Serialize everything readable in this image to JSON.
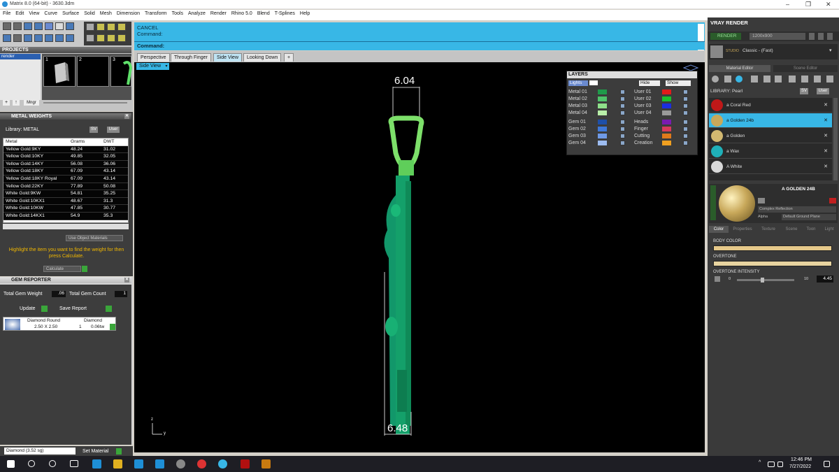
{
  "window": {
    "title": "Matrix 8.0 (64-bit) - 3630.3dm",
    "controls": [
      "–",
      "❐",
      "✕"
    ]
  },
  "menu": [
    "File",
    "Edit",
    "View",
    "Curve",
    "Surface",
    "Solid",
    "Mesh",
    "Dimension",
    "Transform",
    "Tools",
    "Analyze",
    "Render",
    "Rhino 5.0",
    "Blend",
    "T-Splines",
    "Help"
  ],
  "projects": {
    "title": "PROJECTS",
    "tree_item": "render",
    "thumbs": [
      "1",
      "2",
      "3"
    ],
    "btn_plus": "+",
    "btn_up": "↑",
    "btn_mngr": "Mngr"
  },
  "metal_weights": {
    "title": "METAL WEIGHTS",
    "library_label": "Library: METAL",
    "btn_sv": "SV",
    "btn_user": "User",
    "columns": [
      "Metal",
      "Grams",
      "DWT"
    ],
    "rows": [
      [
        "Yellow Gold:9KY",
        "48.24",
        "31.02"
      ],
      [
        "Yellow Gold:10KY",
        "49.85",
        "32.05"
      ],
      [
        "Yellow Gold:14KY",
        "56.08",
        "36.06"
      ],
      [
        "Yellow Gold:18KY",
        "67.09",
        "43.14"
      ],
      [
        "Yellow Gold:18KY Royal",
        "67.09",
        "43.14"
      ],
      [
        "Yellow Gold:22KY",
        "77.89",
        "50.08"
      ],
      [
        "White Gold:9KW",
        "54.81",
        "35.25"
      ],
      [
        "White Gold:10KX1",
        "48.67",
        "31.3"
      ],
      [
        "White Gold:10KW",
        "47.85",
        "30.77"
      ],
      [
        "White Gold:14KX1",
        "54.9",
        "35.3"
      ]
    ],
    "use_object_materials": "Use Object Materials",
    "hint": "Highlight the item you want to find the weight for then press Calculate.",
    "calculate": "Calculate"
  },
  "gem_reporter": {
    "title": "GEM REPORTER",
    "total_weight_label": "Total Gem Weight",
    "total_weight_value": ".06",
    "total_count_label": "Total Gem Count",
    "total_count_value": "1",
    "update": "Update",
    "save_report": "Save Report",
    "gem_shape": "Diamond Round",
    "gem_size": "2.50 X 2.50",
    "gem_type": "Diamond",
    "gem_count": "1",
    "gem_weight": "0.06tw"
  },
  "bottom_bar": {
    "material": "Diamond   (3.52 sg)",
    "set_material": "Set Material"
  },
  "command": {
    "line1": "CANCEL",
    "line2": "Command:",
    "prompt": "Command:"
  },
  "tabs": [
    "Perspective",
    "Through Finger",
    "Side View",
    "Looking Down"
  ],
  "active_tab": "Side View",
  "tab_add": "+",
  "viewport_label": "Side View",
  "dims": {
    "top": "6.04",
    "bottom": "6.48"
  },
  "axis": {
    "z": "z",
    "y": "y"
  },
  "layers": {
    "title": "LAYERS",
    "lights": "Lights",
    "hide": "Hide",
    "show": "Show",
    "left": [
      {
        "name": "Metal 01",
        "color": "#1f9a4a"
      },
      {
        "name": "Metal 02",
        "color": "#4fc36a"
      },
      {
        "name": "Metal 03",
        "color": "#8fe08a"
      },
      {
        "name": "Metal 04",
        "color": "#b9efa9"
      },
      {
        "name": "Gem 01",
        "color": "#1e4fa8"
      },
      {
        "name": "Gem 02",
        "color": "#3f78d8"
      },
      {
        "name": "Gem 03",
        "color": "#6f9ae6"
      },
      {
        "name": "Gem 04",
        "color": "#9dbcf0"
      }
    ],
    "right": [
      {
        "name": "User 01",
        "color": "#e01b1b"
      },
      {
        "name": "User 02",
        "color": "#1bbf2e"
      },
      {
        "name": "User 03",
        "color": "#1b2ee0"
      },
      {
        "name": "User 04",
        "color": "#9a9a9a"
      },
      {
        "name": "Heads",
        "color": "#7a1bb0"
      },
      {
        "name": "Finger",
        "color": "#d93a5a"
      },
      {
        "name": "Cutting",
        "color": "#e07a1b"
      },
      {
        "name": "Creation",
        "color": "#f0a020"
      }
    ]
  },
  "vray": {
    "title": "VRAY RENDER",
    "render_btn": "RENDER",
    "resolution": "1200x900",
    "preset_tag": "STUDIO",
    "preset": "Classic - (Fast)",
    "tabs": [
      "Material Editor",
      "Scene Editor"
    ],
    "library_label": "LIBRARY: Pearl",
    "btn_sv": "SV",
    "btn_user": "User",
    "materials": [
      {
        "name": "a Coral Red",
        "color": "#c01818"
      },
      {
        "name": "a Golden 24b",
        "color": "#c8a85a"
      },
      {
        "name": "a Golden",
        "color": "#d2b870"
      },
      {
        "name": "a Wax",
        "color": "#1fb0b8"
      },
      {
        "name": "A White",
        "color": "#d8d8d8"
      }
    ],
    "selected_index": 1,
    "material_name": "A GOLDEN 24B",
    "reflection": "Complex Reflection",
    "alpha_label": "Alpha",
    "ground": "Default Ground Plane",
    "subtabs": [
      "Color",
      "Properties",
      "Texture",
      "Scene",
      "Toon",
      "Light"
    ],
    "body_color_label": "BODY COLOR",
    "overtone_label": "OVERTONE",
    "overtone_intensity_label": "OVERTONE INTENSITY",
    "intensity_min": "0",
    "intensity_max": "10",
    "intensity_value": "4.45",
    "body_color": "#e6c98a",
    "overtone_color": "#e8d4a0"
  },
  "taskbar": {
    "time": "12:46 PM",
    "date": "7/27/2022",
    "caret": "^"
  }
}
